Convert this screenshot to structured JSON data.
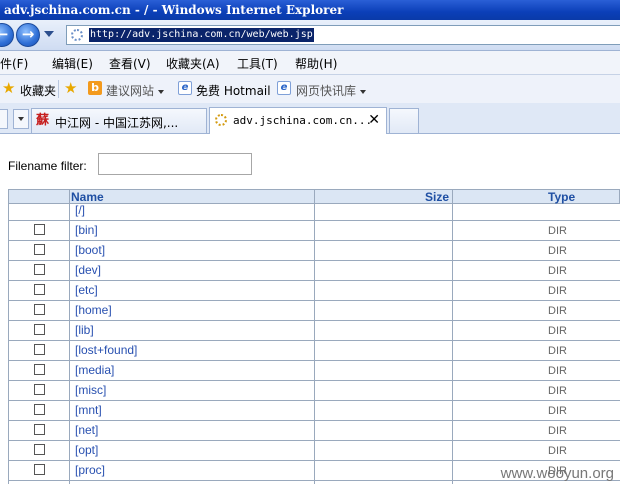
{
  "window": {
    "title": "adv.jschina.com.cn - / - Windows Internet Explorer"
  },
  "address": {
    "url": "http://adv.jschina.com.cn/web/web.jsp"
  },
  "menu": [
    "文件(F)",
    "编辑(E)",
    "查看(V)",
    "收藏夹(A)",
    "工具(T)",
    "帮助(H)"
  ],
  "favorites": {
    "label": "收藏夹",
    "items": [
      "建议网站",
      "免费 Hotmail",
      "网页快讯库"
    ]
  },
  "tabs": [
    {
      "title": "中江网 - 中国江苏网,..."
    },
    {
      "title": "adv.jschina.com.cn...",
      "close": "✕"
    }
  ],
  "filter": {
    "label": "Filename filter:",
    "value": ""
  },
  "table": {
    "headers": {
      "name": "Name",
      "size": "Size",
      "type": "Type"
    },
    "rows": [
      {
        "name": "[/]",
        "type": ""
      },
      {
        "name": "[bin]",
        "type": "DIR"
      },
      {
        "name": "[boot]",
        "type": "DIR"
      },
      {
        "name": "[dev]",
        "type": "DIR"
      },
      {
        "name": "[etc]",
        "type": "DIR"
      },
      {
        "name": "[home]",
        "type": "DIR"
      },
      {
        "name": "[lib]",
        "type": "DIR"
      },
      {
        "name": "[lost+found]",
        "type": "DIR"
      },
      {
        "name": "[media]",
        "type": "DIR"
      },
      {
        "name": "[misc]",
        "type": "DIR"
      },
      {
        "name": "[mnt]",
        "type": "DIR"
      },
      {
        "name": "[net]",
        "type": "DIR"
      },
      {
        "name": "[opt]",
        "type": "DIR"
      },
      {
        "name": "[proc]",
        "type": "DIR"
      }
    ]
  },
  "watermark": "www.wooyun.org",
  "colors": {
    "titlebar": "#0b3fb8",
    "link": "#2850b0",
    "header_bg": "#dbe6f4"
  }
}
